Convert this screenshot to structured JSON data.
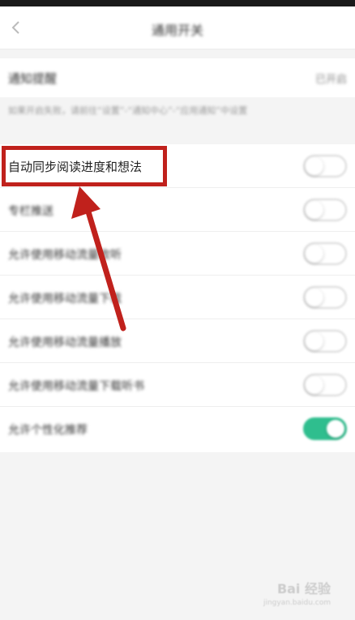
{
  "header": {
    "title": "通用开关"
  },
  "notify": {
    "label": "通知提醒",
    "status": "已开启"
  },
  "hint": "如果开启失败，请前往“设置”-“通知中心”-“应用通知”中设置",
  "rows": [
    {
      "label": "自动同步阅读进度和想法",
      "on": false
    },
    {
      "label": "专栏推送",
      "on": false
    },
    {
      "label": "允许使用移动流量收听",
      "on": false
    },
    {
      "label": "允许使用移动流量下载",
      "on": false
    },
    {
      "label": "允许使用移动流量播放",
      "on": false
    },
    {
      "label": "允许使用移动流量下载听书",
      "on": false
    },
    {
      "label": "允许个性化推荐",
      "on": true
    }
  ],
  "colors": {
    "accent_green": "#2fbe8e",
    "annotation_red": "#c0211c"
  },
  "watermark": {
    "brand": "Bai 经验",
    "url": "jingyan.baidu.com"
  }
}
